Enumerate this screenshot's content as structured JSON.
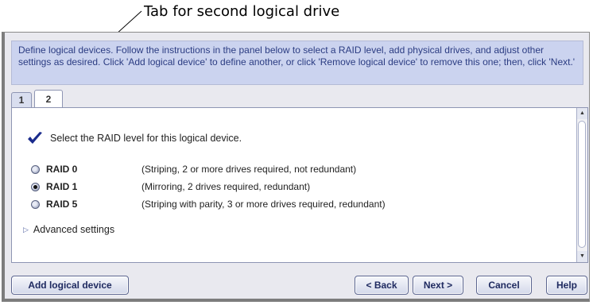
{
  "callout": {
    "text": "Tab for second logical drive"
  },
  "instructions": "Define logical devices.  Follow the instructions in the panel below to select a RAID level, add physical drives, and adjust other settings as desired.  Click 'Add logical device' to define another, or click 'Remove logical device' to remove this one; then, click 'Next.'",
  "tabs": [
    {
      "label": "1"
    },
    {
      "label": "2"
    }
  ],
  "selected_tab": "2",
  "panel": {
    "prompt": "Select the RAID level for this logical device.",
    "raid_options": [
      {
        "name": "RAID 0",
        "description": "(Striping, 2 or more drives required, not redundant)",
        "selected": false
      },
      {
        "name": "RAID 1",
        "description": "(Mirroring, 2 drives required, redundant)",
        "selected": true
      },
      {
        "name": "RAID 5",
        "description": "(Striping with parity, 3 or more drives required, redundant)",
        "selected": false
      }
    ],
    "advanced_label": "Advanced settings"
  },
  "buttons": {
    "add": "Add logical device",
    "back": "< Back",
    "next": "Next >",
    "cancel": "Cancel",
    "help": "Help"
  },
  "colors": {
    "instruction_bg": "#cbd3ef",
    "instruction_text": "#2b3c82",
    "accent": "#1f2a60",
    "checkmark": "#1a2b8c"
  },
  "icons": {
    "check": "check-icon",
    "expand": "triangle-right-icon",
    "radio": "radio-icon"
  }
}
